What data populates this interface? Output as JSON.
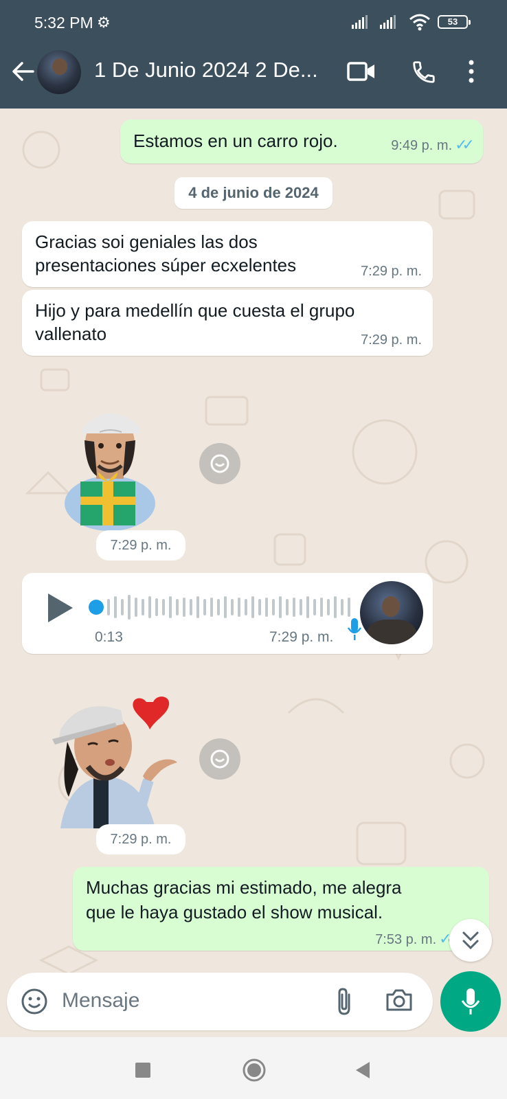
{
  "status_bar": {
    "time": "5:32 PM",
    "battery": "53"
  },
  "header": {
    "title": "1 De Junio 2024 2 De..."
  },
  "messages": [
    {
      "text": "Estamos en un carro rojo.",
      "time": "9:49 p. m."
    },
    {
      "date": "4 de junio de 2024"
    },
    {
      "text_line1": "Gracias soi geniales las dos",
      "text_line2": "presentaciones súper ecxelentes",
      "time": "7:29 p. m."
    },
    {
      "text_line1": "Hijo y para medellín que cuesta el grupo",
      "text_line2": "vallenato",
      "time": "7:29 p. m."
    },
    {
      "sticker": "gift-sticker",
      "time": "7:29 p. m."
    },
    {
      "voice_duration": "0:13",
      "time": "7:29 p. m."
    },
    {
      "sticker": "kiss-heart-sticker",
      "time": "7:29 p. m."
    },
    {
      "text_line1": "Muchas gracias mi estimado, me alegra",
      "text_line2": "que le haya gustado el show musical.",
      "time": "7:53 p. m."
    }
  ],
  "composer": {
    "placeholder": "Mensaje"
  },
  "colors": {
    "header": "#3b4f5c",
    "outgoing_bubble": "#d9fdd3",
    "incoming_bubble": "#ffffff",
    "accent": "#00a884",
    "read_ticks": "#53bdeb"
  },
  "icons": [
    "settings-gear-icon",
    "signal-icon",
    "wifi-icon",
    "battery-icon",
    "back-arrow-icon",
    "video-call-icon",
    "phone-icon",
    "more-vert-icon",
    "forward-icon",
    "play-icon",
    "mic-icon",
    "emoji-icon",
    "paperclip-icon",
    "camera-icon",
    "chevrons-down-icon",
    "nav-square-icon",
    "nav-circle-icon",
    "nav-back-triangle-icon"
  ]
}
